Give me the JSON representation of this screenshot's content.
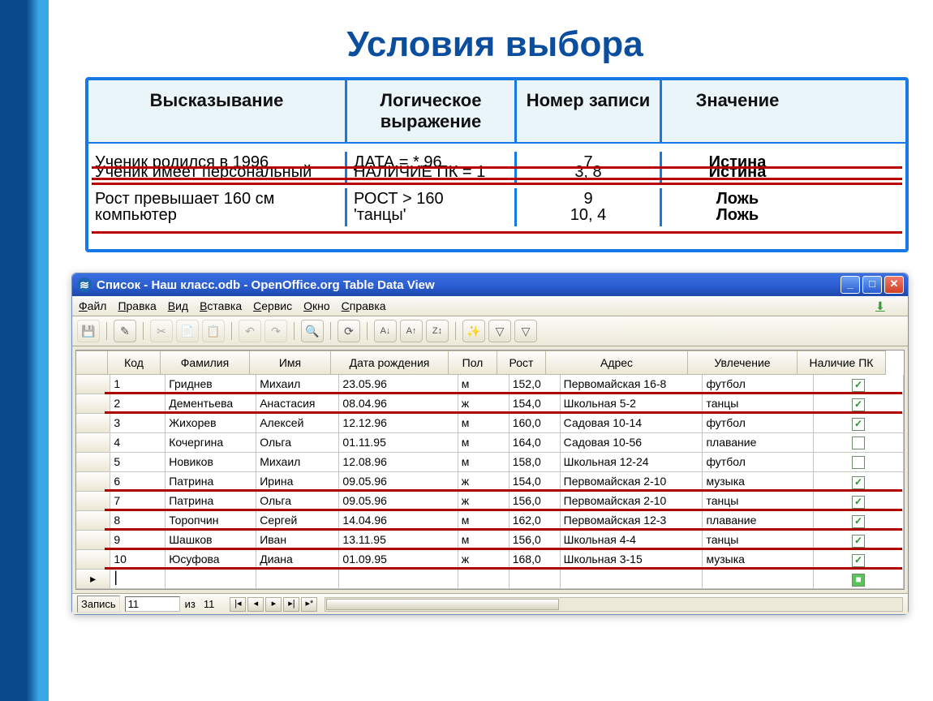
{
  "page_title": "Условия выбора",
  "conditions_table": {
    "headers": {
      "statement": "Высказывание",
      "expression": "Логическое выражение",
      "record_no": "Номер записи",
      "value": "Значение"
    },
    "rows": [
      {
        "statement": "Ученик родился в 1996",
        "expression": "ДАТА = *.96",
        "record_no": "7",
        "value": "Истина",
        "value_class": "val-true"
      },
      {
        "statement": "Ученик имеет персональный",
        "expression": "НАЛИЧИЕ ПК = 1",
        "record_no": "3, 8",
        "value": "Истина",
        "value_class": "val-true"
      },
      {
        "statement": "Рост превышает 160 см",
        "expression": "РОСТ > 160",
        "record_no": "9",
        "value": "Ложь",
        "value_class": "val-false"
      },
      {
        "statement": "компьютер",
        "expression": "'танцы'",
        "record_no": "10, 4",
        "value": "Ложь",
        "value_class": "val-false"
      }
    ]
  },
  "window": {
    "title": "Список - Наш класс.odb - OpenOffice.org Table Data View",
    "menus": [
      "Файл",
      "Правка",
      "Вид",
      "Вставка",
      "Сервис",
      "Окно",
      "Справка"
    ],
    "toolbar_tooltips": {
      "save": "Сохранить",
      "edit": "Правка",
      "cut": "Вырезать",
      "copy": "Копировать",
      "paste": "Вставить",
      "undo": "Отменить",
      "redo": "Вернуть",
      "find": "Найти",
      "refresh": "Обновить",
      "sort_asc": "По возрастанию",
      "sort_desc": "По убыванию",
      "sort": "Сортировка",
      "autofilter": "Автофильтр",
      "filter": "Стандартный фильтр",
      "filter_off": "Снять фильтр"
    },
    "columns": [
      "Код",
      "Фамилия",
      "Имя",
      "Дата рождения",
      "Пол",
      "Рост",
      "Адрес",
      "Увлечение",
      "Наличие ПК"
    ],
    "rows": [
      {
        "hl": true,
        "code": "1",
        "fam": "Гриднев",
        "name": "Михаил",
        "date": "23.05.96",
        "sex": "м",
        "height": "152,0",
        "addr": "Первомайская 16-8",
        "hobby": "футбол",
        "pc": true
      },
      {
        "hl": true,
        "code": "2",
        "fam": "Дементьева",
        "name": "Анастасия",
        "date": "08.04.96",
        "sex": "ж",
        "height": "154,0",
        "addr": "Школьная 5-2",
        "hobby": "танцы",
        "pc": true
      },
      {
        "hl": false,
        "code": "3",
        "fam": "Жихорев",
        "name": "Алексей",
        "date": "12.12.96",
        "sex": "м",
        "height": "160,0",
        "addr": "Садовая 10-14",
        "hobby": "футбол",
        "pc": true
      },
      {
        "hl": false,
        "code": "4",
        "fam": "Кочергина",
        "name": "Ольга",
        "date": "01.11.95",
        "sex": "м",
        "height": "164,0",
        "addr": "Садовая 10-56",
        "hobby": "плавание",
        "pc": false
      },
      {
        "hl": false,
        "code": "5",
        "fam": "Новиков",
        "name": "Михаил",
        "date": "12.08.96",
        "sex": "м",
        "height": "158,0",
        "addr": "Школьная 12-24",
        "hobby": "футбол",
        "pc": false
      },
      {
        "hl": true,
        "code": "6",
        "fam": "Патрина",
        "name": "Ирина",
        "date": "09.05.96",
        "sex": "ж",
        "height": "154,0",
        "addr": "Первомайская 2-10",
        "hobby": "музыка",
        "pc": true
      },
      {
        "hl": true,
        "code": "7",
        "fam": "Патрина",
        "name": "Ольга",
        "date": "09.05.96",
        "sex": "ж",
        "height": "156,0",
        "addr": "Первомайская 2-10",
        "hobby": "танцы",
        "pc": true
      },
      {
        "hl": true,
        "code": "8",
        "fam": "Торопчин",
        "name": "Сергей",
        "date": "14.04.96",
        "sex": "м",
        "height": "162,0",
        "addr": "Первомайская 12-3",
        "hobby": "плавание",
        "pc": true
      },
      {
        "hl": true,
        "code": "9",
        "fam": "Шашков",
        "name": "Иван",
        "date": "13.11.95",
        "sex": "м",
        "height": "156,0",
        "addr": "Школьная 4-4",
        "hobby": "танцы",
        "pc": true
      },
      {
        "hl": true,
        "code": "10",
        "fam": "Юсуфова",
        "name": "Диана",
        "date": "01.09.95",
        "sex": "ж",
        "height": "168,0",
        "addr": "Школьная 3-15",
        "hobby": "музыка",
        "pc": true
      }
    ],
    "statusbar": {
      "record_label": "Запись",
      "current": "11",
      "of_label": "из",
      "total": "11"
    }
  }
}
